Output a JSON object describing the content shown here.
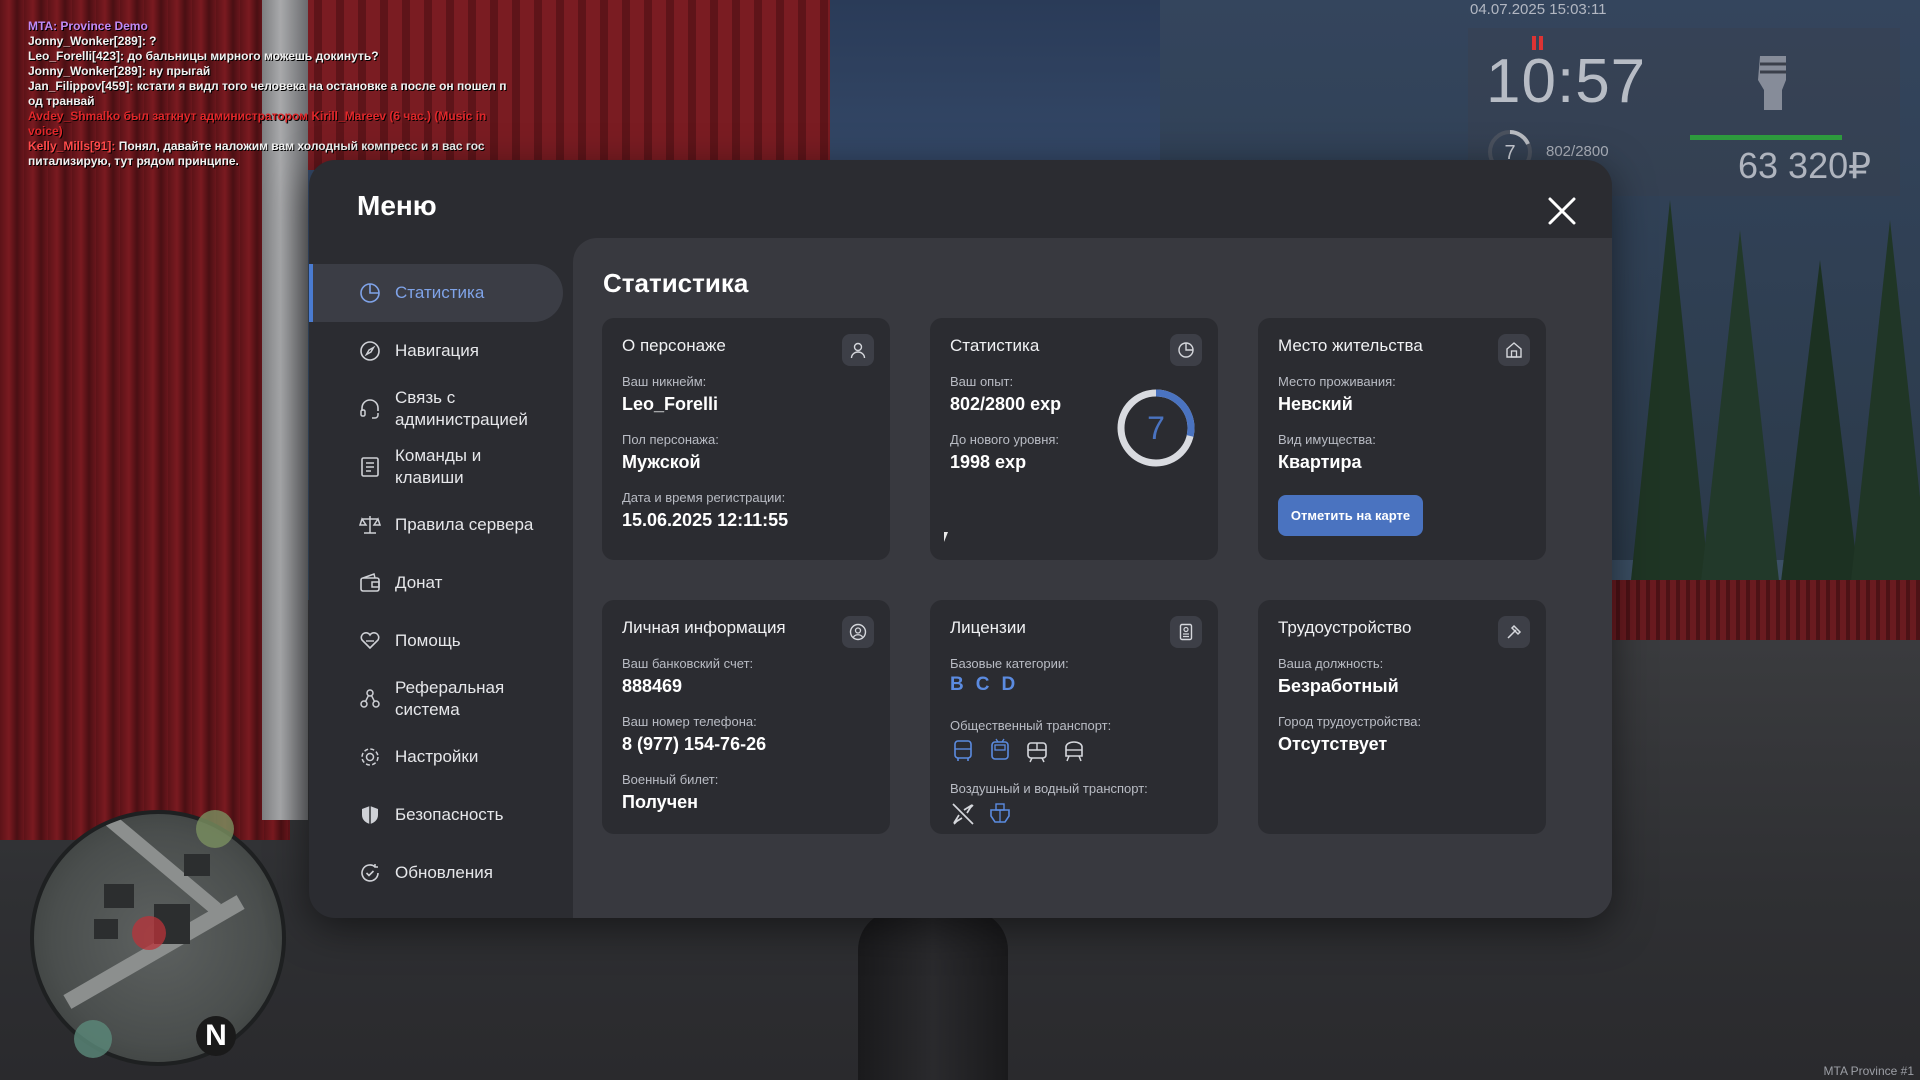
{
  "chat": {
    "lines": [
      {
        "text": "MTA: Province Demo"
      },
      {
        "text": "Jonny_Wonker[289]: ?"
      },
      {
        "text": "Leo_Forelli[423]: до бальницы мирного можешь докинуть?"
      },
      {
        "text": "Jonny_Wonker[289]: ну прыгай"
      },
      {
        "text": "Jan_Filippov[459]: кстати я видл того человека на остановке а после он пошел п"
      },
      {
        "text": "од транвай"
      },
      {
        "text": "Avdey_Shmalko был заткнут администратором Kirill_Mareev (6 час.) (Music in"
      },
      {
        "text": "voice)"
      },
      {
        "name": "Kelly_Mills[91]:",
        "text": " Понял, давайте наложим вам холодный компресс и я вас гос"
      },
      {
        "text": "питализирую, тут рядом принципе."
      }
    ]
  },
  "hud": {
    "datetime": "04.07.2025 15:03:11",
    "clock": "10:57",
    "level": "7",
    "exp": "802/2800",
    "money": "63 320₽",
    "bar_fill": 0.8
  },
  "minimap": {
    "north": "N"
  },
  "watermark": "MTA Province #1",
  "menu": {
    "title": "Меню",
    "nav": [
      {
        "label": "Статистика",
        "icon": "pie-chart-icon"
      },
      {
        "label": "Навигация",
        "icon": "compass-icon"
      },
      {
        "label": "Связь с администрацией",
        "icon": "headset-icon"
      },
      {
        "label": "Команды и клавиши",
        "icon": "document-icon"
      },
      {
        "label": "Правила сервера",
        "icon": "scales-icon"
      },
      {
        "label": "Донат",
        "icon": "wallet-icon"
      },
      {
        "label": "Помощь",
        "icon": "heart-hands-icon"
      },
      {
        "label": "Реферальная система",
        "icon": "referral-icon"
      },
      {
        "label": "Настройки",
        "icon": "gear-icon"
      },
      {
        "label": "Безопасность",
        "icon": "shield-icon"
      },
      {
        "label": "Обновления",
        "icon": "refresh-check-icon"
      }
    ]
  },
  "content": {
    "title": "Статистика",
    "character": {
      "title": "О персонаже",
      "nick_label": "Ваш никнейм:",
      "nick": "Leo_Forelli",
      "gender_label": "Пол персонажа:",
      "gender": "Мужской",
      "reg_label": "Дата и время регистрации:",
      "reg": "15.06.2025 12:11:55"
    },
    "stats": {
      "title": "Статистика",
      "exp_label": "Ваш опыт:",
      "exp": "802/2800 exp",
      "next_label": "До нового уровня:",
      "next": "1998 exp",
      "level": "7",
      "progress": 0.286
    },
    "residence": {
      "title": "Место жительства",
      "place_label": "Место проживания:",
      "place": "Невский",
      "type_label": "Вид имущества:",
      "type": "Квартира",
      "button": "Отметить на карте"
    },
    "personal": {
      "title": "Личная информация",
      "bank_label": "Ваш банковский счет:",
      "bank": "888469",
      "phone_label": "Ваш номер телефона:",
      "phone": "8 (977) 154-76-26",
      "military_label": "Военный билет:",
      "military": "Получен"
    },
    "licenses": {
      "title": "Лицензии",
      "base_label": "Базовые категории:",
      "categories": [
        "B",
        "C",
        "D"
      ],
      "public_label": "Общественный транспорт:",
      "public_icons": [
        "bus-icon",
        "trolleybus-icon",
        "tram-icon",
        "metro-icon"
      ],
      "air_label": "Воздушный и водный транспорт:",
      "air_icons": [
        "plane-icon",
        "boat-icon"
      ]
    },
    "employment": {
      "title": "Трудоустройство",
      "job_label": "Ваша должность:",
      "job": "Безработный",
      "city_label": "Город трудоустройства:",
      "city": "Отсутствует"
    }
  },
  "colors": {
    "accent": "#4a7bd0",
    "card_bg": "#2b2c31",
    "panel_bg": "#38393f",
    "modal_bg": "#2b2c31",
    "category": "#5b8be0"
  }
}
